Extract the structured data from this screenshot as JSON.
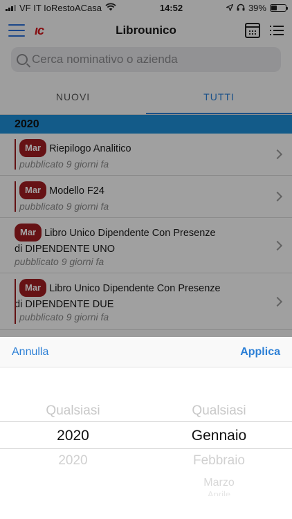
{
  "status_bar": {
    "carrier": "VF IT IoRestoACasa",
    "time": "14:52",
    "battery": "39%"
  },
  "nav": {
    "logo": "ıc",
    "title": "Librounico",
    "accent_color": "#2b6fd6",
    "logo_color": "#d0161b"
  },
  "search": {
    "placeholder": "Cerca nominativo o azienda"
  },
  "tabs": [
    {
      "label": "NUOVI",
      "active": false
    },
    {
      "label": "TUTTI",
      "active": true
    }
  ],
  "section": {
    "year": "2020"
  },
  "documents": [
    {
      "badge": "Mar",
      "title": "Riepilogo Analitico",
      "subtitle": "pubblicato 9 giorni fa"
    },
    {
      "badge": "Mar",
      "title": "Modello F24",
      "subtitle": "pubblicato 9 giorni fa"
    },
    {
      "badge": "Mar",
      "title": "Libro Unico Dipendente Con Presenze",
      "title2": "di DIPENDENTE UNO",
      "subtitle": "pubblicato 9 giorni fa"
    },
    {
      "badge": "Mar",
      "title": "Libro Unico Dipendente Con Presenze",
      "title2": "di DIPENDENTE DUE",
      "subtitle": "pubblicato 9 giorni fa"
    }
  ],
  "picker": {
    "cancel_label": "Annulla",
    "apply_label": "Applica",
    "year_wheel": {
      "above": "Qualsiasi",
      "selected": "2020",
      "below": "2020"
    },
    "month_wheel": {
      "above": "Qualsiasi",
      "selected": "Gennaio",
      "below": "Febbraio",
      "below2": "Marzo",
      "below3": "Aprile"
    }
  }
}
